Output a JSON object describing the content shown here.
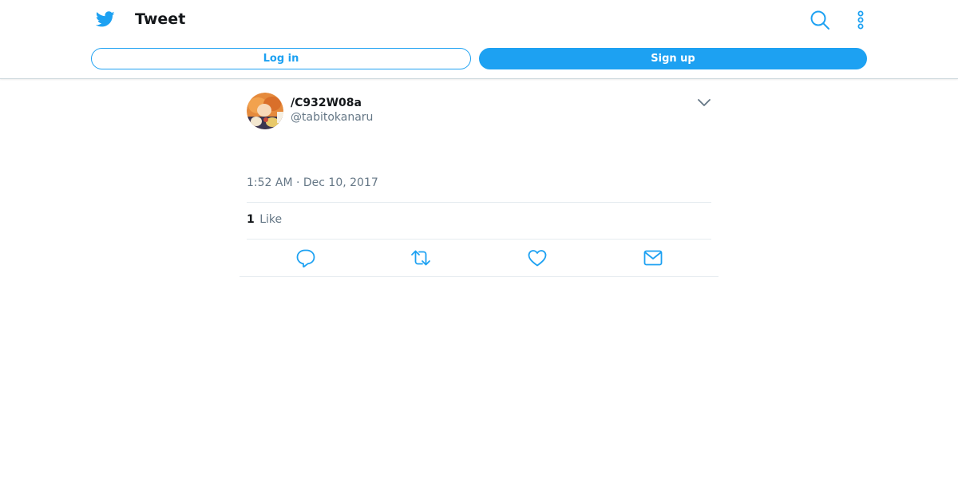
{
  "header": {
    "title": "Tweet",
    "login_label": "Log in",
    "signup_label": "Sign up"
  },
  "tweet": {
    "display_name": "/C932W08a",
    "handle": "@tabitokanaru",
    "timestamp": "1:52 AM · Dec 10, 2017",
    "like_count": "1",
    "like_label": "Like"
  },
  "icons": {
    "logo": "twitter-bird-icon",
    "search": "search-icon",
    "more": "more-vertical-icon",
    "caret": "chevron-down-icon",
    "reply": "reply-icon",
    "retweet": "retweet-icon",
    "like": "heart-icon",
    "dm": "mail-icon"
  },
  "colors": {
    "brand": "#1da1f2",
    "text": "#14171a",
    "secondary_text": "#657786",
    "border": "#e6ecf0"
  }
}
